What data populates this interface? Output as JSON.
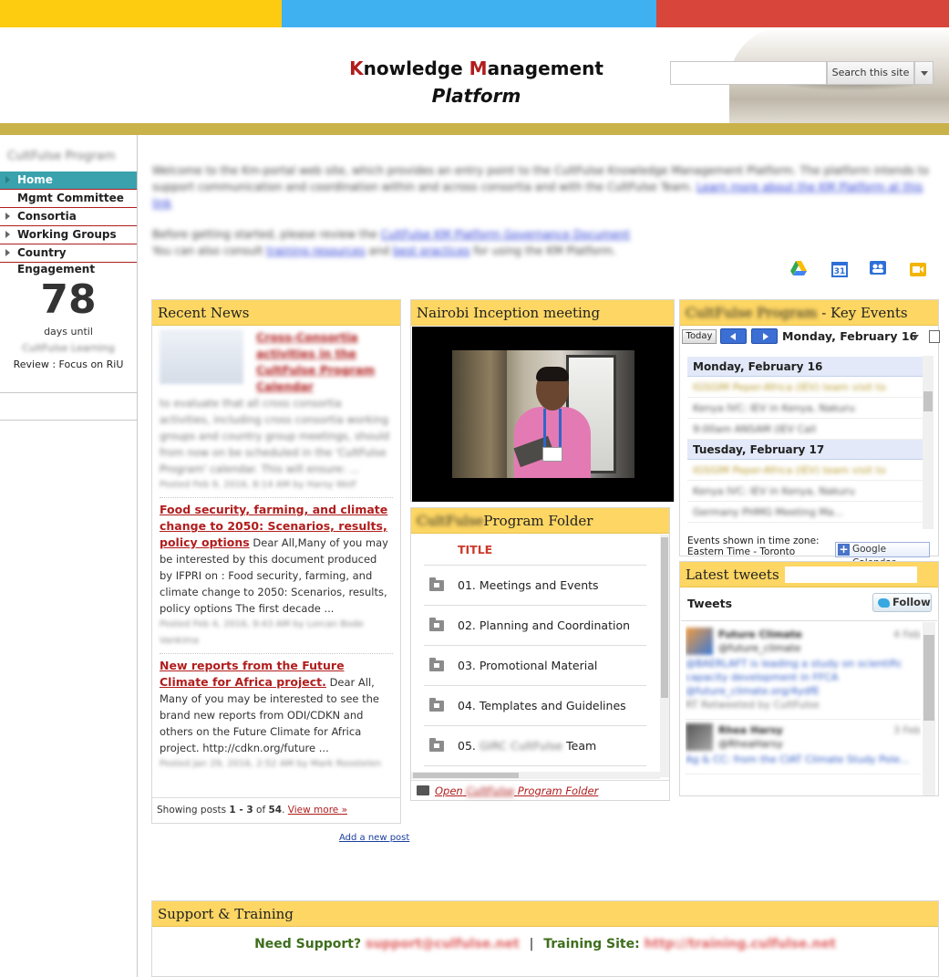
{
  "header": {
    "title_line1_k": "K",
    "title_line1_rest1": "nowledge ",
    "title_line1_m": "M",
    "title_line1_rest2": "anagement",
    "title_line2": "Platform",
    "search_button": "Search this site"
  },
  "sidebar": {
    "program_name": "CultFulse Program",
    "items": [
      {
        "label": "Home",
        "active": true,
        "expandable": false
      },
      {
        "label": "Mgmt Committee",
        "active": false,
        "expandable": false
      },
      {
        "label": "Consortia",
        "active": false,
        "expandable": true
      },
      {
        "label": "Working Groups",
        "active": false,
        "expandable": true
      },
      {
        "label": "Country Engagement",
        "active": false,
        "expandable": true
      }
    ],
    "countdown": {
      "number": "78",
      "label": "days until",
      "blurred_event": "CultFulse Learning",
      "review": "Review : Focus on RiU"
    }
  },
  "intro": {
    "p1": "Welcome to the Km-portal web site, which provides an entry point to the CultFulse Knowledge Management Platform. The platform intends to support communication and coordination within and across consortia and with the CultFulse Team.",
    "p1_link": "Learn more about the KM Platform at this link",
    "p2a": "Before getting started, please review the",
    "p2_link": "CultFulse KM Platform Governance Document",
    "p3a": "You can also consult",
    "p3_link1": "training resources",
    "p3b": "and",
    "p3_link2": "best practices",
    "p3c": "for using the KM Platform."
  },
  "toolbar_icons": [
    "drive-icon",
    "calendar-icon",
    "groups-icon",
    "hangout-icon"
  ],
  "recent_news": {
    "title": "Recent News",
    "posts": [
      {
        "title": "Cross-Consortia activities in the CultFulse Program Calendar",
        "excerpt": "to evaluate that all cross consortia activities, including cross consortia working groups and country group meetings, should from now on be scheduled in the 'CultFulse Program' calendar. This will ensure: ...",
        "meta": "Posted Feb 9, 2016, 8:14 AM by Harsy Wolf"
      },
      {
        "title": "Food security, farming, and climate change to 2050: Scenarios, results, policy options",
        "excerpt": "Dear All,Many of you may be interested by this document produced by IFPRI on : Food security, farming, and climate change to 2050: Scenarios, results, policy options The first decade ...",
        "meta": "Posted Feb 4, 2016, 9:43 AM by Lorcan Bode Vankima"
      },
      {
        "title": "New reports from the Future Climate for Africa project.",
        "excerpt": "Dear All, Many of you may be interested to see the brand new reports from ODI/CDKN and others on the Future Climate for Africa project. http://cdkn.org/future ...",
        "meta": "Posted Jan 29, 2016, 2:52 AM by Mark Roostelen"
      }
    ],
    "footer_prefix": "Showing posts ",
    "footer_range": "1 - 3",
    "footer_of": " of ",
    "footer_total": "54",
    "footer_view_more": "View more »",
    "add_post": "Add a new post"
  },
  "inception": {
    "title": "Nairobi Inception meeting"
  },
  "program_folder": {
    "title_blur": "CultFulse",
    "title": "Program Folder",
    "column_header": "TITLE",
    "rows": [
      {
        "label": "01. Meetings and Events"
      },
      {
        "label": "02. Planning and Coordination"
      },
      {
        "label": "03. Promotional Material"
      },
      {
        "label": "04. Templates and Guidelines"
      },
      {
        "label_prefix": "05.",
        "label_blur": "GIRC CultFulse",
        "label_suffix": "Team"
      }
    ],
    "footer_open": "Open",
    "footer_blur": "CultFulse",
    "footer_suffix": "Program Folder"
  },
  "key_events": {
    "title_blur": "CultFulse Program",
    "title": "- Key Events",
    "today": "Today",
    "current_date": "Monday, February 16",
    "days": [
      {
        "day": "Monday, February 16",
        "events": [
          "IGSGIM Peper-Africa (IEV) team visit to",
          "Kenya IVC: IEV in Kenya, Nakuru",
          "9:00am    ANSAM (IEV Call"
        ]
      },
      {
        "day": "Tuesday, February 17",
        "events": [
          "IGSGIM Peper-Africa (IEV) team visit to",
          "Kenya IVC: IEV in Kenya, Nakuru",
          "Germany PHMG Meeting Ma..."
        ]
      }
    ],
    "timezone_label": "Events shown in time zone:",
    "timezone": "Eastern Time - Toronto",
    "gcal_button": "Google Calendar"
  },
  "tweets": {
    "title": "Latest tweets",
    "header": "Tweets",
    "follow": "Follow",
    "items": [
      {
        "name": "Future Climate",
        "handle": "@future_climate",
        "text": "@BAERLAFT is leading a study on scientific capacity development in FFCA @future_climate.org/4ydfE",
        "meta": "RT Retweeted by CultFulse",
        "time": "4 Feb"
      },
      {
        "name": "Rhea Harsy",
        "handle": "@RheaHarsy",
        "text": "Ag & CC: from the CIAT Climate Study Pole...",
        "meta": "",
        "time": "3 Feb"
      }
    ]
  },
  "support": {
    "title": "Support & Training",
    "need_support": "Need Support?",
    "support_email": "support@culfulse.net",
    "separator": "|",
    "training_label": "Training Site:",
    "training_url": "http://training.culfulse.net"
  },
  "colors": {
    "yellow": "#fdcb0f",
    "blue": "#3fb0f0",
    "red": "#d8453a",
    "gold_band": "#c9b24a",
    "gadget_header": "#fdd663",
    "nav_active": "#3aa2ad",
    "link_red": "#b11d1d"
  }
}
